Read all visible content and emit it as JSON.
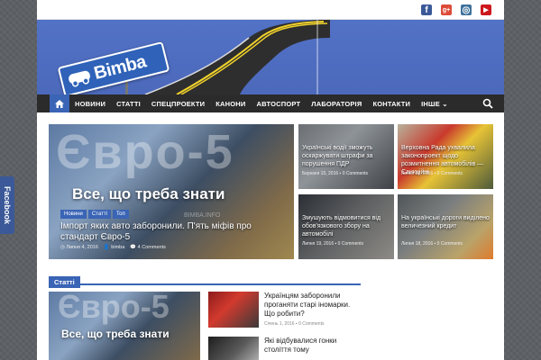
{
  "sidebar_tab": {
    "label": "Facebook"
  },
  "social": [
    {
      "name": "facebook-icon",
      "glyph": "f",
      "color": "#3b5998"
    },
    {
      "name": "google-plus-icon",
      "glyph": "g+",
      "color": "#dd4b39"
    },
    {
      "name": "instagram-icon",
      "glyph": "◎",
      "color": "#3f729b"
    },
    {
      "name": "youtube-icon",
      "glyph": "▶",
      "color": "#cc181e"
    }
  ],
  "logo": {
    "text": "Bimba"
  },
  "nav": {
    "items": [
      "НОВИНИ",
      "СТАТТІ",
      "СПЕЦПРОЕКТИ",
      "КАНОНИ",
      "АВТОСПОРТ",
      "ЛАБОРАТОРІЯ",
      "КОНТАКТИ",
      "ІНШЕ"
    ]
  },
  "featured": {
    "big_overlay": "Євро-5",
    "headline": "Все, що треба знати",
    "tags": [
      "Новини",
      "Статті",
      "Топ"
    ],
    "watermark": "BIMBA.INFO",
    "title": "Імпорт яких авто заборонили. П'ять міфів про стандарт Євро-5",
    "date": "Липня 4, 2016",
    "author": "bimba",
    "comments": "4 Comments"
  },
  "small_posts": [
    {
      "title": "Українські водії зможуть оскаржувати штрафи за порушення ПДР",
      "meta1": "Березня 15, 2016",
      "meta2": "0 Comments",
      "bg": "linear-gradient(135deg,#6b6f74 0%,#8e9398 40%,#3e4246 100%)"
    },
    {
      "title": "Верховна Рада ухвалила законопроект щодо розмитнення автомобілів — Санкційні",
      "meta1": "Липня 28, 2016",
      "meta2": "0 Comments",
      "bg": "linear-gradient(135deg,#b7b29c 0%,#c93a2d 35%,#e7c336 55%,#4d5a3b 100%)"
    },
    {
      "title": "Змушують відмовитися від обов'язкового збору на автомобілі",
      "meta1": "Липня 19, 2016",
      "meta2": "0 Comments",
      "bg": "linear-gradient(135deg,#2b2f35 0%,#5c5e60 45%,#8d8b86 100%)"
    },
    {
      "title": "На українські дороги виділено величезний кредит",
      "meta1": "Липня 18, 2016",
      "meta2": "0 Comments",
      "bg": "linear-gradient(135deg,#4f5558 0%,#7c7f7f 40%,#b9a36a 75%,#e07a2c 100%)"
    }
  ],
  "section": {
    "label": "Статті"
  },
  "feat2": {
    "overlay": "Євро-5",
    "headline": "Все, що треба знати"
  },
  "list": [
    {
      "title": "Українцям заборонили проганяти старі іномарки. Що робити?",
      "date": "Січень 1, 2016",
      "comments": "0 Comments"
    },
    {
      "title": "Які відбувалися гонки століття тому",
      "date": "",
      "comments": ""
    }
  ]
}
